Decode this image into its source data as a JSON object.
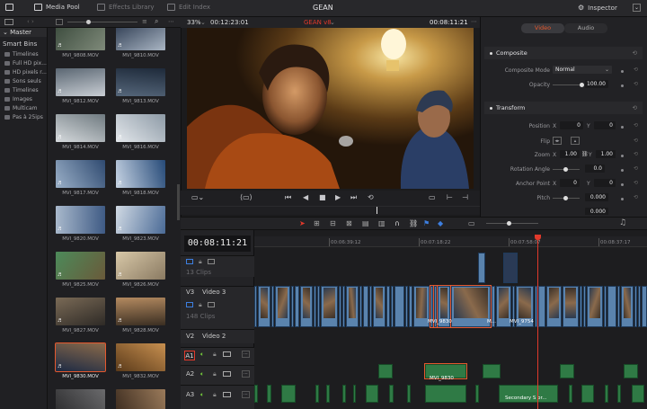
{
  "topbar": {
    "media_pool": "Media Pool",
    "effects_library": "Effects Library",
    "edit_index": "Edit Index",
    "project_title": "GEAN",
    "inspector": "Inspector"
  },
  "viewer": {
    "zoom": "33%",
    "source_timecode": "00:12:23:01",
    "timeline_name": "GEAN v8",
    "record_timecode": "00:08:11:21"
  },
  "sidebar": {
    "master": "Master",
    "smart_bins": "Smart Bins",
    "items": [
      "Timelines",
      "Full HD pix...",
      "HD pixels r...",
      "Sons seuls",
      "Timelines",
      "Images",
      "Multicam",
      "Pas à 25ips"
    ]
  },
  "clips": [
    {
      "name": "MVI_9808.MOV",
      "colors": [
        "#3a4a3c",
        "#7f8a7a"
      ]
    },
    {
      "name": "MVI_9810.MOV",
      "colors": [
        "#2c3a50",
        "#aab6c4"
      ]
    },
    {
      "name": "MVI_9812.MOV",
      "colors": [
        "#5a6672",
        "#c9ced4"
      ]
    },
    {
      "name": "MVI_9813.MOV",
      "colors": [
        "#1e2a3a",
        "#55667a"
      ]
    },
    {
      "name": "MVI_9814.MOV",
      "colors": [
        "#6f7a80",
        "#d6dadd"
      ]
    },
    {
      "name": "MVI_9816.MOV",
      "colors": [
        "#8d9aa6",
        "#e4e8ec"
      ]
    },
    {
      "name": "MVI_9817.MOV",
      "colors": [
        "#2f4a70",
        "#9bb0c8"
      ]
    },
    {
      "name": "MVI_9818.MOV",
      "colors": [
        "#264a78",
        "#c7d4e4"
      ]
    },
    {
      "name": "MVI_9820.MOV",
      "colors": [
        "#3e5a84",
        "#a9b9cc"
      ]
    },
    {
      "name": "MVI_9823.MOV",
      "colors": [
        "#4a6a96",
        "#d1dae4"
      ]
    },
    {
      "name": "MVI_9825.MOV",
      "colors": [
        "#6a5a3a",
        "#4c8a5a"
      ]
    },
    {
      "name": "MVI_9826.MOV",
      "colors": [
        "#8a7a62",
        "#d8c8a8"
      ]
    },
    {
      "name": "MVI_9827.MOV",
      "colors": [
        "#2e2a26",
        "#7a6a56"
      ]
    },
    {
      "name": "MVI_9828.MOV",
      "colors": [
        "#3a2e22",
        "#b48a60"
      ]
    },
    {
      "name": "MVI_9830.MOV",
      "colors": [
        "#1c2a44",
        "#8a6a4a"
      ]
    },
    {
      "name": "MVI_9832.MOV",
      "colors": [
        "#5a3a1a",
        "#c89050"
      ]
    },
    {
      "name": "",
      "colors": [
        "#2a2a2c",
        "#6a6a6c"
      ]
    },
    {
      "name": "",
      "colors": [
        "#3a2a1e",
        "#9a7a5a"
      ]
    }
  ],
  "selected_clip": "MVI_9830.MOV",
  "inspector": {
    "tabs": [
      "Video",
      "Audio"
    ],
    "composite": {
      "title": "Composite",
      "mode_label": "Composite Mode",
      "mode_value": "Normal",
      "opacity_label": "Opacity",
      "opacity_value": "100.00"
    },
    "transform": {
      "title": "Transform",
      "position_label": "Position",
      "x_label": "X",
      "y_label": "Y",
      "position_x": "0",
      "position_y": "0",
      "flip_label": "Flip",
      "zoom_label": "Zoom",
      "zoom_x": "1.00",
      "zoom_y": "1.00",
      "rotation_label": "Rotation Angle",
      "rotation_value": "0.0",
      "anchor_label": "Anchor Point",
      "anchor_x": "0",
      "anchor_y": "0",
      "pitch_label": "Pitch",
      "pitch_value": "0.000",
      "yaw_value": "0.000"
    }
  },
  "timeline": {
    "timecode": "00:08:11:21",
    "ruler_ticks": [
      "00:06:39:12",
      "00:07:18:22",
      "00:07:58:07",
      "00:08:37:17"
    ],
    "tracks": {
      "v4_clips": "13 Clips",
      "v3_id": "V3",
      "v3_name": "Video 3",
      "v3_clips": "148 Clips",
      "v2_id": "V2",
      "v2_name": "Video 2",
      "a1_id": "A1",
      "a2_id": "A2",
      "a3_id": "A3"
    },
    "clip_labels": {
      "v_selected": "MVI_9830",
      "v_dots": "M...",
      "v_other": "MVI_9754",
      "a_selected": "MVI_9830",
      "a3_label": "Secondary S or..."
    }
  },
  "colors": {
    "accent_orange": "#e4582e",
    "playhead": "#e0392b",
    "video_clip": "#5a83ad",
    "audio_clip": "#2f7a45",
    "timecode_red": "#e0392b"
  }
}
